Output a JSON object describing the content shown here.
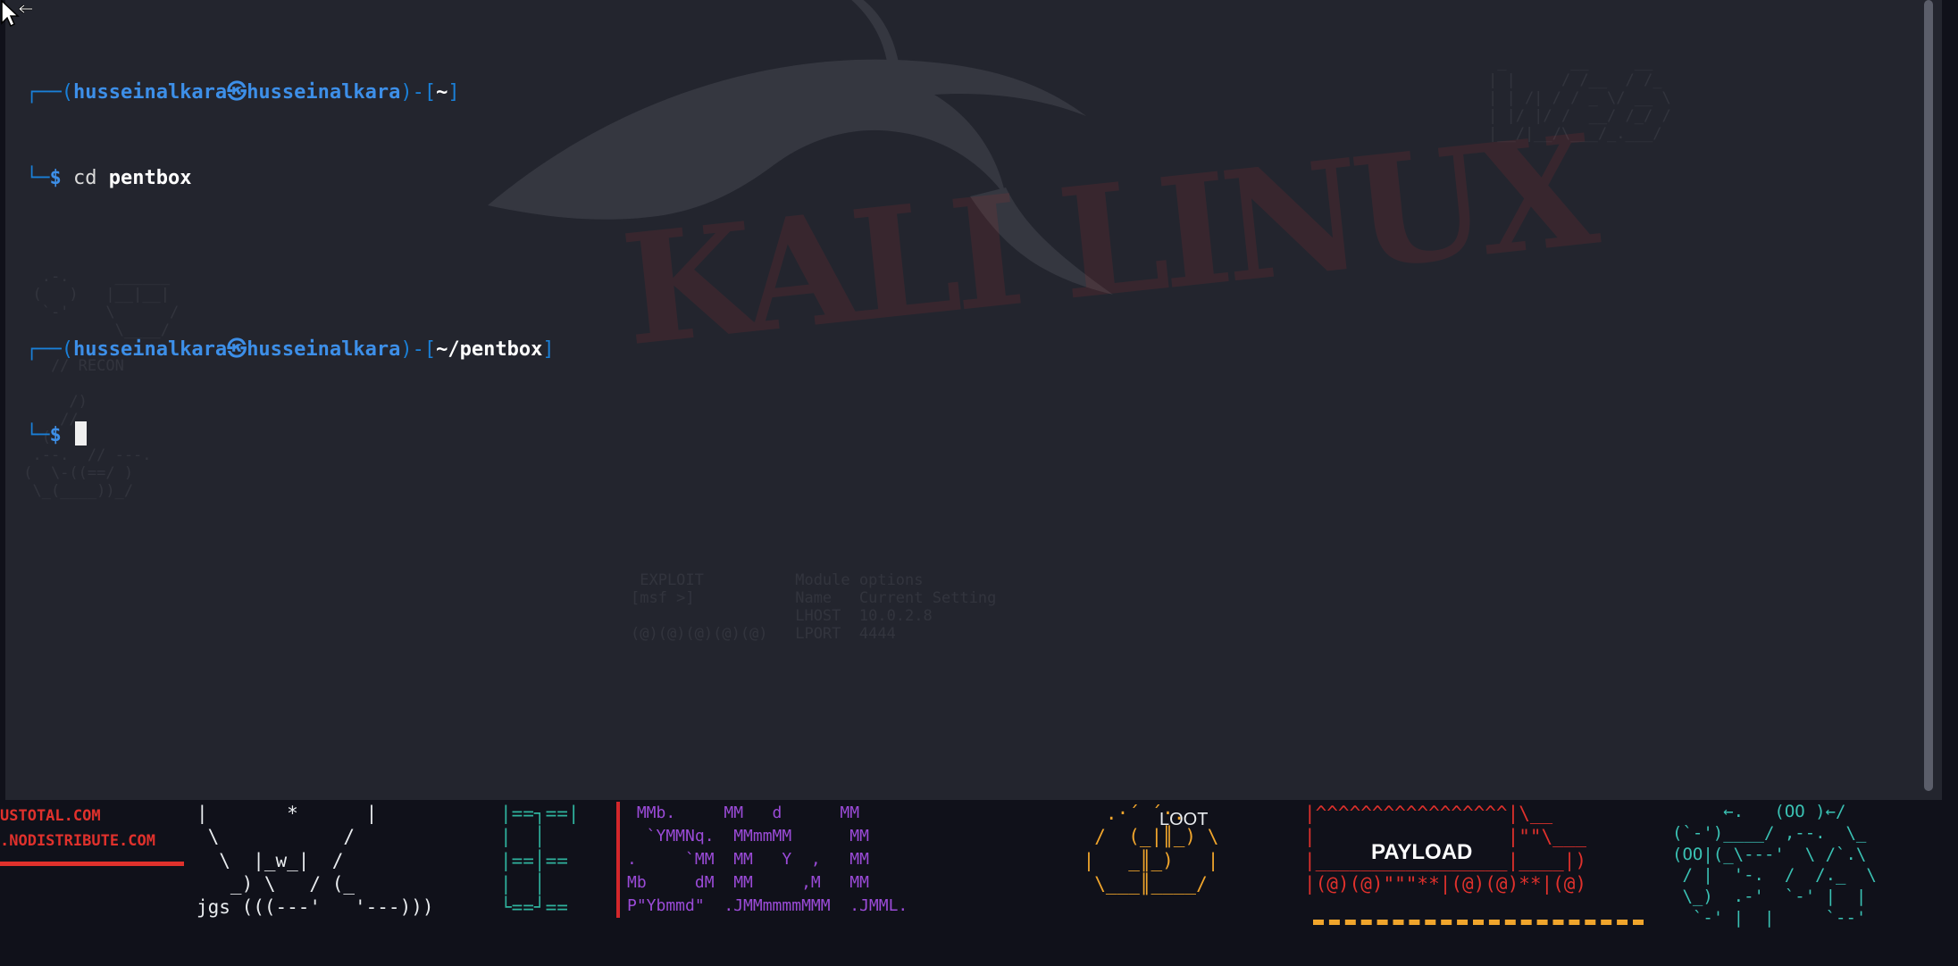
{
  "wallpaper": {
    "red_text": "USTOTAL.COM\n.NODISTRIBUTE.COM",
    "robot_art": "|       *      |\n \\           /\n  \\  |_w_|  /\n   _) \\   / (_\njgs (((---'   '---)))",
    "teal_box_art": "|==┐==|\n|  │   \n|==│== \n|  │   \n└==┘== ",
    "purple_art": " MMb.     MM   d      MM\n  `YMMNq.  MMmmMM      MM\n.     `MM  MM   Y  ,   MM\nMb     dM  MM     ,M   MM\nP\"Ybmmd\"  .JMMmmmmMMM  .JMML.",
    "loot_label": "LOOT",
    "loot_art": "   .·´ ´·.\n  /  (_|║_) \\\n |   _║_)   |\n  \\___║____/ ",
    "payload_label": "PAYLOAD",
    "payload_art": "|^^^^^^^^^^^^^^^^^|\\__\n|                 |\"\"\\___\n|_________________|____|)\n|(@)(@)\"\"\"**|(@)(@)**|(@)",
    "teal_art": "     ←.   (OO )←/\n(`-')____/ ,--.  \\_\n(OO|(_\\---'  \\ /`.\\\n / |  '-.  /  /._  \\\n \\_)  .-'  `-' |  |\n  `-' |  |     `--'"
  },
  "terminal": {
    "background_art": {
      "kali_title": "KALI LINUX",
      "scene_left": "   .-.     ______\n  (   )   |__|__|\n   `-'    \\      /\n           \\____/\n\n    // RECON\n\n      /)\n     //\n   ((\n  .--.  // ---.\n (  \\-((==/ )\n  \\_(____))_/",
      "scene_mid": " EXPLOIT          Module options\n[msf >]           Name   Current Setting\n                  LHOST  10.0.2.8\n(@)(@)(@)(@)(@)   LPORT  4444",
      "scene_right": " _       __     __\n| |     / /__  / /_\n| | /| / / _ \\/ __ \\\n| |/ |/ /  __/ /_/ /\n|__/|__/\\___/_.___/"
    },
    "lines": [
      {
        "frame_open": "┌──(",
        "user": "husseinalkara",
        "at": "㉿",
        "host": "husseinalkara",
        "frame_mid": ")-[",
        "path": "~",
        "frame_close": "]"
      },
      {
        "frame": "└─",
        "prompt": "$ ",
        "cmd": "cd",
        "arg": " pentbox"
      },
      {
        "frame_open": "┌──(",
        "user": "husseinalkara",
        "at": "㉿",
        "host": "husseinalkara",
        "frame_mid": ")-[",
        "path": "~/pentbox",
        "frame_close": "]"
      },
      {
        "frame": "└─",
        "prompt": "$ "
      }
    ]
  },
  "colors": {
    "terminal_bg": "#24262f",
    "prompt_blue": "#3d8fe8",
    "kali_red": "#e0312c"
  },
  "icons": {
    "mouse_cursor": "resize-arrow-icon"
  }
}
